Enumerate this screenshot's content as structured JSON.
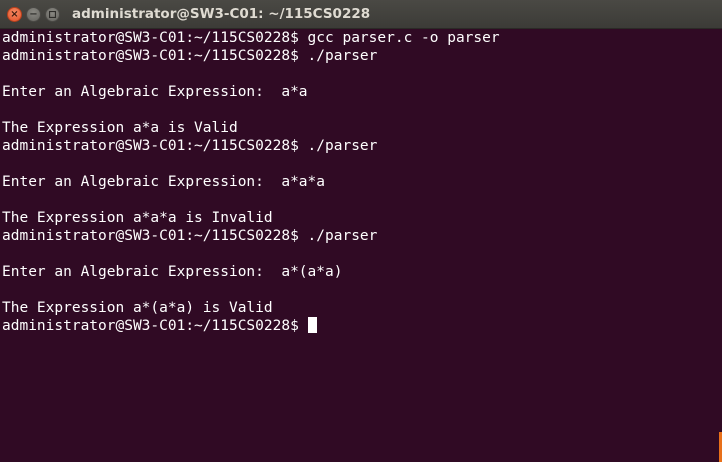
{
  "window": {
    "title": "administrator@SW3-C01: ~/115CS0228",
    "close_glyph": "×",
    "min_glyph": "−",
    "accent_close": "#e2522a",
    "background": "#300a24"
  },
  "terminal": {
    "lines": [
      "administrator@SW3-C01:~/115CS0228$ gcc parser.c -o parser",
      "administrator@SW3-C01:~/115CS0228$ ./parser",
      "",
      "Enter an Algebraic Expression:  a*a",
      "",
      "The Expression a*a is Valid",
      "administrator@SW3-C01:~/115CS0228$ ./parser",
      "",
      "Enter an Algebraic Expression:  a*a*a",
      "",
      "The Expression a*a*a is Invalid",
      "administrator@SW3-C01:~/115CS0228$ ./parser",
      "",
      "Enter an Algebraic Expression:  a*(a*a)",
      "",
      "The Expression a*(a*a) is Valid"
    ],
    "prompt": "administrator@SW3-C01:~/115CS0228$"
  }
}
